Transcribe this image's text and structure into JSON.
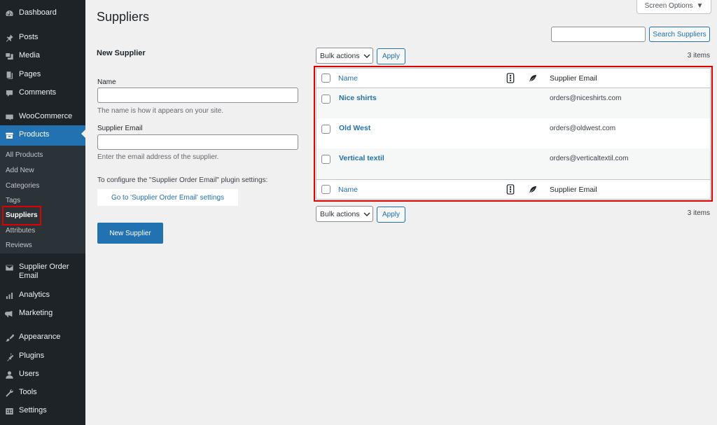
{
  "sidebar": {
    "items": [
      {
        "label": "Dashboard",
        "icon": "dashboard-icon"
      },
      {
        "label": "Posts",
        "icon": "pin-icon"
      },
      {
        "label": "Media",
        "icon": "media-icon"
      },
      {
        "label": "Pages",
        "icon": "pages-icon"
      },
      {
        "label": "Comments",
        "icon": "comment-icon"
      },
      {
        "label": "WooCommerce",
        "icon": "woo-icon"
      },
      {
        "label": "Products",
        "icon": "archive-icon",
        "active": true
      },
      {
        "label": "Supplier Order",
        "label2": "Email",
        "icon": "email-icon"
      },
      {
        "label": "Analytics",
        "icon": "chart-icon"
      },
      {
        "label": "Marketing",
        "icon": "megaphone-icon"
      },
      {
        "label": "Appearance",
        "icon": "brush-icon"
      },
      {
        "label": "Plugins",
        "icon": "plugin-icon"
      },
      {
        "label": "Users",
        "icon": "user-icon"
      },
      {
        "label": "Tools",
        "icon": "wrench-icon"
      },
      {
        "label": "Settings",
        "icon": "settings-icon"
      }
    ],
    "submenu": [
      "All Products",
      "Add New",
      "Categories",
      "Tags",
      "Suppliers",
      "Attributes",
      "Reviews"
    ]
  },
  "header": {
    "title": "Suppliers",
    "screen_options": "Screen Options"
  },
  "search": {
    "value": "",
    "button": "Search Suppliers"
  },
  "form": {
    "heading": "New Supplier",
    "name_label": "Name",
    "name_value": "",
    "name_desc": "The name is how it appears on your site.",
    "email_label": "Supplier Email",
    "email_value": "",
    "email_desc": "Enter the email address of the supplier.",
    "config_text": "To configure the \"Supplier Order Email\" plugin settings:",
    "config_button": "Go to 'Supplier Order Email' settings",
    "submit": "New Supplier"
  },
  "table": {
    "bulk_actions": "Bulk actions",
    "apply": "Apply",
    "count": "3 items",
    "columns": {
      "name": "Name",
      "email": "Supplier Email"
    },
    "rows": [
      {
        "name": "Nice shirts",
        "email": "orders@niceshirts.com"
      },
      {
        "name": "Old West",
        "email": "orders@oldwest.com"
      },
      {
        "name": "Vertical textil",
        "email": "orders@verticaltextil.com"
      }
    ]
  },
  "colors": {
    "accent": "#2271b1",
    "sidebar_bg": "#1d2327",
    "highlight": "#e00000"
  }
}
